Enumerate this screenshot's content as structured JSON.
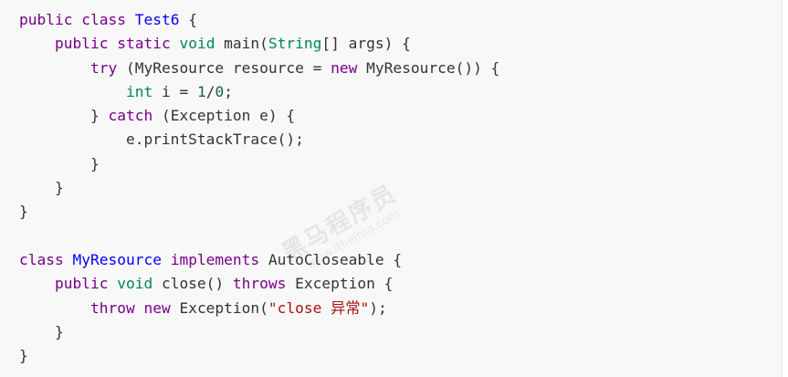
{
  "code_lines": [
    [
      [
        "kw",
        "public"
      ],
      [
        "plain",
        " "
      ],
      [
        "kw",
        "class"
      ],
      [
        "plain",
        " "
      ],
      [
        "cls",
        "Test6"
      ],
      [
        "plain",
        " {"
      ]
    ],
    [
      [
        "plain",
        "    "
      ],
      [
        "kw",
        "public"
      ],
      [
        "plain",
        " "
      ],
      [
        "kw",
        "static"
      ],
      [
        "plain",
        " "
      ],
      [
        "ty",
        "void"
      ],
      [
        "plain",
        " main("
      ],
      [
        "ty",
        "String"
      ],
      [
        "plain",
        "[] args) {"
      ]
    ],
    [
      [
        "plain",
        "        "
      ],
      [
        "kw",
        "try"
      ],
      [
        "plain",
        " (MyResource resource = "
      ],
      [
        "kw",
        "new"
      ],
      [
        "plain",
        " MyResource()) {"
      ]
    ],
    [
      [
        "plain",
        "            "
      ],
      [
        "ty",
        "int"
      ],
      [
        "plain",
        " i = "
      ],
      [
        "num",
        "1"
      ],
      [
        "plain",
        "/"
      ],
      [
        "num",
        "0"
      ],
      [
        "plain",
        ";"
      ]
    ],
    [
      [
        "plain",
        "        } "
      ],
      [
        "kw",
        "catch"
      ],
      [
        "plain",
        " (Exception e) {"
      ]
    ],
    [
      [
        "plain",
        "            e.printStackTrace();"
      ]
    ],
    [
      [
        "plain",
        "        }"
      ]
    ],
    [
      [
        "plain",
        "    }"
      ]
    ],
    [
      [
        "plain",
        "}"
      ]
    ],
    [
      [
        "plain",
        ""
      ]
    ],
    [
      [
        "kw",
        "class"
      ],
      [
        "plain",
        " "
      ],
      [
        "cls",
        "MyResource"
      ],
      [
        "plain",
        " "
      ],
      [
        "kw",
        "implements"
      ],
      [
        "plain",
        " AutoCloseable {"
      ]
    ],
    [
      [
        "plain",
        "    "
      ],
      [
        "kw",
        "public"
      ],
      [
        "plain",
        " "
      ],
      [
        "ty",
        "void"
      ],
      [
        "plain",
        " close() "
      ],
      [
        "kw",
        "throws"
      ],
      [
        "plain",
        " Exception {"
      ]
    ],
    [
      [
        "plain",
        "        "
      ],
      [
        "kw",
        "throw"
      ],
      [
        "plain",
        " "
      ],
      [
        "kw",
        "new"
      ],
      [
        "plain",
        " Exception("
      ],
      [
        "str",
        "\"close 异常\""
      ],
      [
        "plain",
        ");"
      ]
    ],
    [
      [
        "plain",
        "    }"
      ]
    ],
    [
      [
        "plain",
        "}"
      ]
    ]
  ],
  "watermark": {
    "text": "黑马程序员",
    "url": "www.itheima.com"
  },
  "colors": {
    "keyword": "#770088",
    "type": "#008855",
    "class_name": "#0000ff",
    "number": "#116644",
    "string": "#aa1111",
    "text": "#333333",
    "background": "#f8f8f8"
  }
}
